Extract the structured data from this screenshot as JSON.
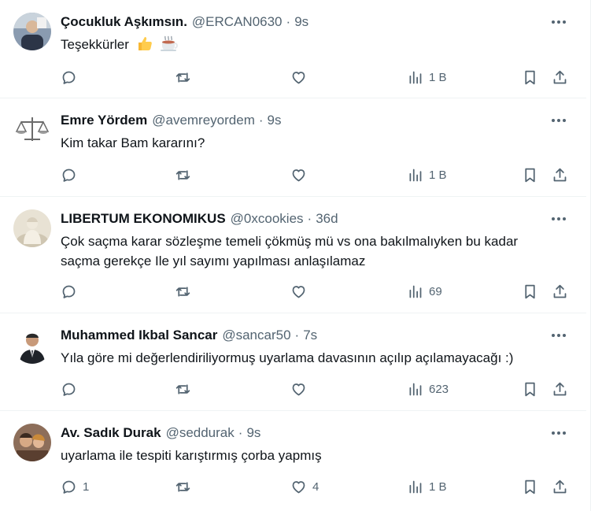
{
  "colors": {
    "text": "#0f1419",
    "secondary": "#536471",
    "divider": "#eff3f4"
  },
  "tweets": [
    {
      "name": "Çocukluk Aşkımsın.",
      "handle": "@ERCAN0630",
      "separator": "·",
      "time": "9s",
      "text": "Teşekkürler",
      "emojis": [
        "thumbs-up",
        "hot-beverage"
      ],
      "replies": "",
      "retweets": "",
      "likes": "",
      "views": "1 B"
    },
    {
      "name": "Emre Yördem",
      "handle": "@avemreyordem",
      "separator": "·",
      "time": "9s",
      "text": "Kim takar Bam kararını?",
      "replies": "",
      "retweets": "",
      "likes": "",
      "views": "1 B"
    },
    {
      "name": "LIBERTUM EKONOMIKUS",
      "handle": "@0xcookies",
      "separator": "·",
      "time": "36d",
      "text": "Çok saçma karar sözleşme temeli çökmüş mü vs ona bakılmalıyken bu kadar saçma gerekçe Ile yıl sayımı yapılması anlaşılamaz",
      "replies": "",
      "retweets": "",
      "likes": "",
      "views": "69"
    },
    {
      "name": "Muhammed Ikbal Sancar",
      "handle": "@sancar50",
      "separator": "·",
      "time": "7s",
      "text": "Yıla göre mi değerlendiriliyormuş uyarlama davasının açılıp açılamayacağı :)",
      "replies": "",
      "retweets": "",
      "likes": "",
      "views": "623"
    },
    {
      "name": "Av. Sadık Durak",
      "handle": "@seddurak",
      "separator": "·",
      "time": "9s",
      "text": "uyarlama ile tespiti karıştırmış çorba yapmış",
      "replies": "1",
      "retweets": "",
      "likes": "4",
      "views": "1 B"
    }
  ]
}
